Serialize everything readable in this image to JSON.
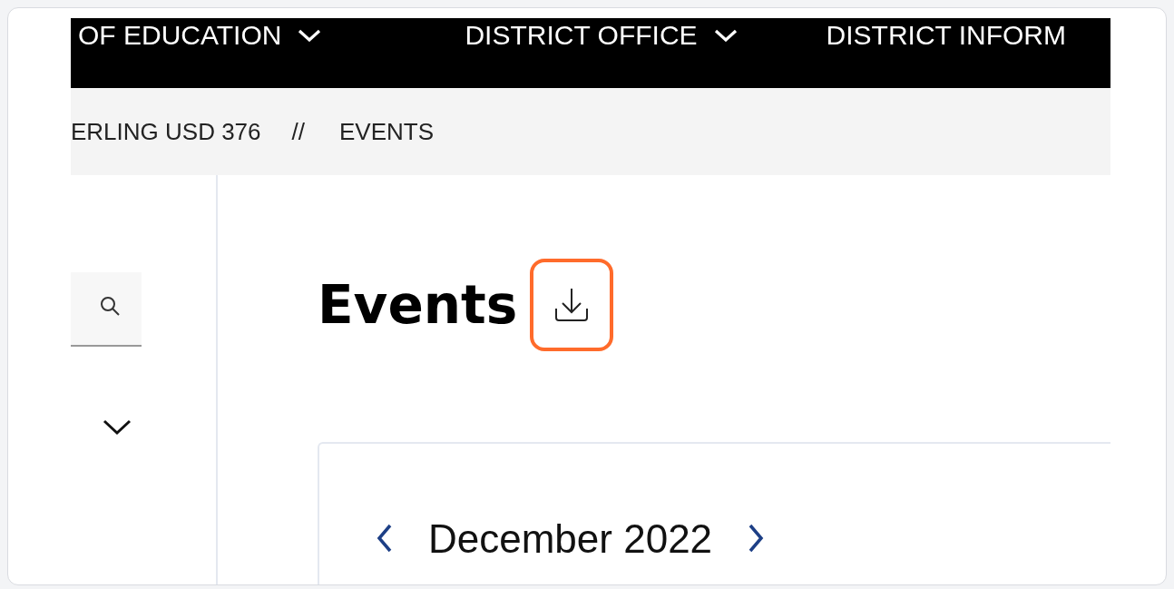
{
  "nav": [
    {
      "label": "OF EDUCATION",
      "has_menu": true
    },
    {
      "label": "DISTRICT OFFICE",
      "has_menu": true
    },
    {
      "label": "DISTRICT INFORM",
      "has_menu": false
    }
  ],
  "breadcrumb": {
    "items": [
      "ERLING USD 376",
      "EVENTS"
    ],
    "separator": "//"
  },
  "page": {
    "title": "Events",
    "download_highlighted": true
  },
  "calendar": {
    "month": "December 2022"
  }
}
